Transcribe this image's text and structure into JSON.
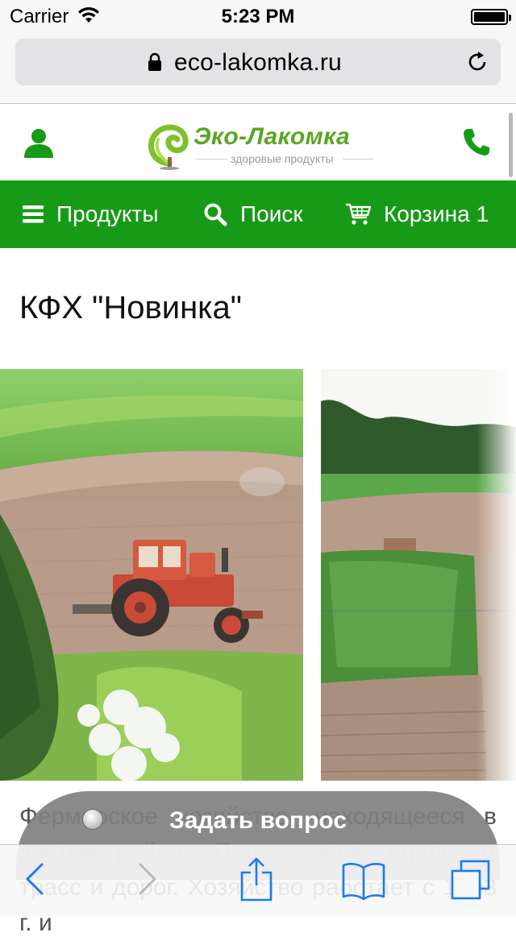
{
  "status_bar": {
    "carrier": "Carrier",
    "time": "5:23 PM",
    "icons": [
      "wifi-icon",
      "battery-icon"
    ]
  },
  "browser": {
    "url": "eco-lakomka.ru",
    "icons": [
      "lock-icon",
      "reload-icon"
    ]
  },
  "header": {
    "logo_title": "Эко-Лакомка",
    "logo_subtitle": "здоровые продукты",
    "icons": [
      "user-icon",
      "phone-icon"
    ],
    "brand_color": "#5aa624"
  },
  "nav": {
    "background": "#189a19",
    "products_label": "Продукты",
    "search_label": "Поиск",
    "cart_label": "Корзина",
    "cart_count": "1"
  },
  "page": {
    "title": "КФХ \"Новинка\"",
    "body_text": "Фермерское хозяйство, находящееся в чистом районе Подмосковья, вдали от трасс и дорог. Хозяйство работает с 1993 г. и"
  },
  "ask_button": {
    "label": "Задать вопрос"
  },
  "toolbar": {
    "icons": [
      "back-icon",
      "forward-icon",
      "share-icon",
      "bookmarks-icon",
      "tabs-icon"
    ]
  }
}
